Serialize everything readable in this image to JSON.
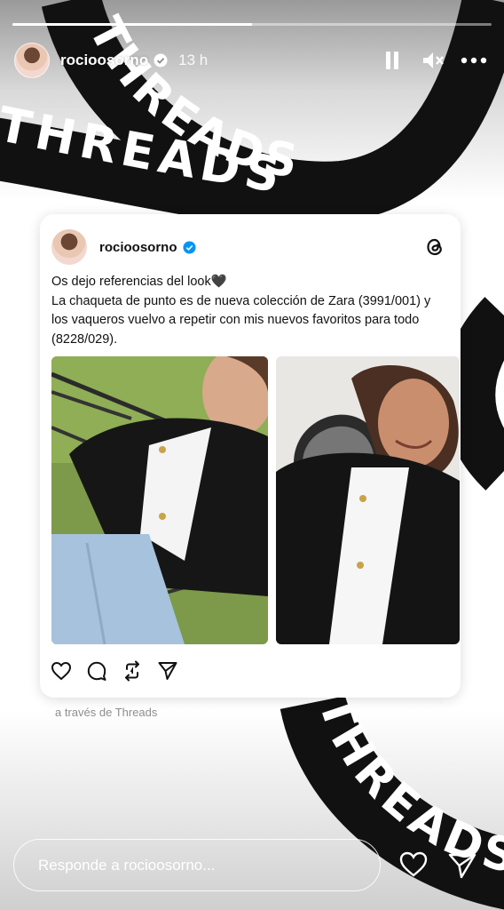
{
  "story": {
    "progress_fraction": 0.5,
    "username": "rocioosorno",
    "time_ago": "13 h",
    "via_text": "a través de Threads"
  },
  "background": {
    "ring_text": "THREADS"
  },
  "post": {
    "username": "rocioosorno",
    "text_lines": [
      "Os dejo referencias del look🖤",
      "La chaqueta de punto es de nueva colección de Zara (3991/001) y",
      "los vaqueros vuelvo a repetir con mis nuevos favoritos para todo",
      "(8228/029)."
    ]
  },
  "icons": {
    "verified": "verified-badge-icon",
    "threads": "threads-logo-icon",
    "pause": "pause-icon",
    "mute": "muted-speaker-icon",
    "more": "more-options-icon",
    "like": "heart-icon",
    "comment": "comment-icon",
    "repost": "repost-icon",
    "share": "share-icon",
    "send": "send-icon"
  },
  "reply": {
    "placeholder": "Responde a rocioosorno..."
  },
  "colors": {
    "verified_blue": "#0095f6",
    "ring_black": "#111111"
  }
}
